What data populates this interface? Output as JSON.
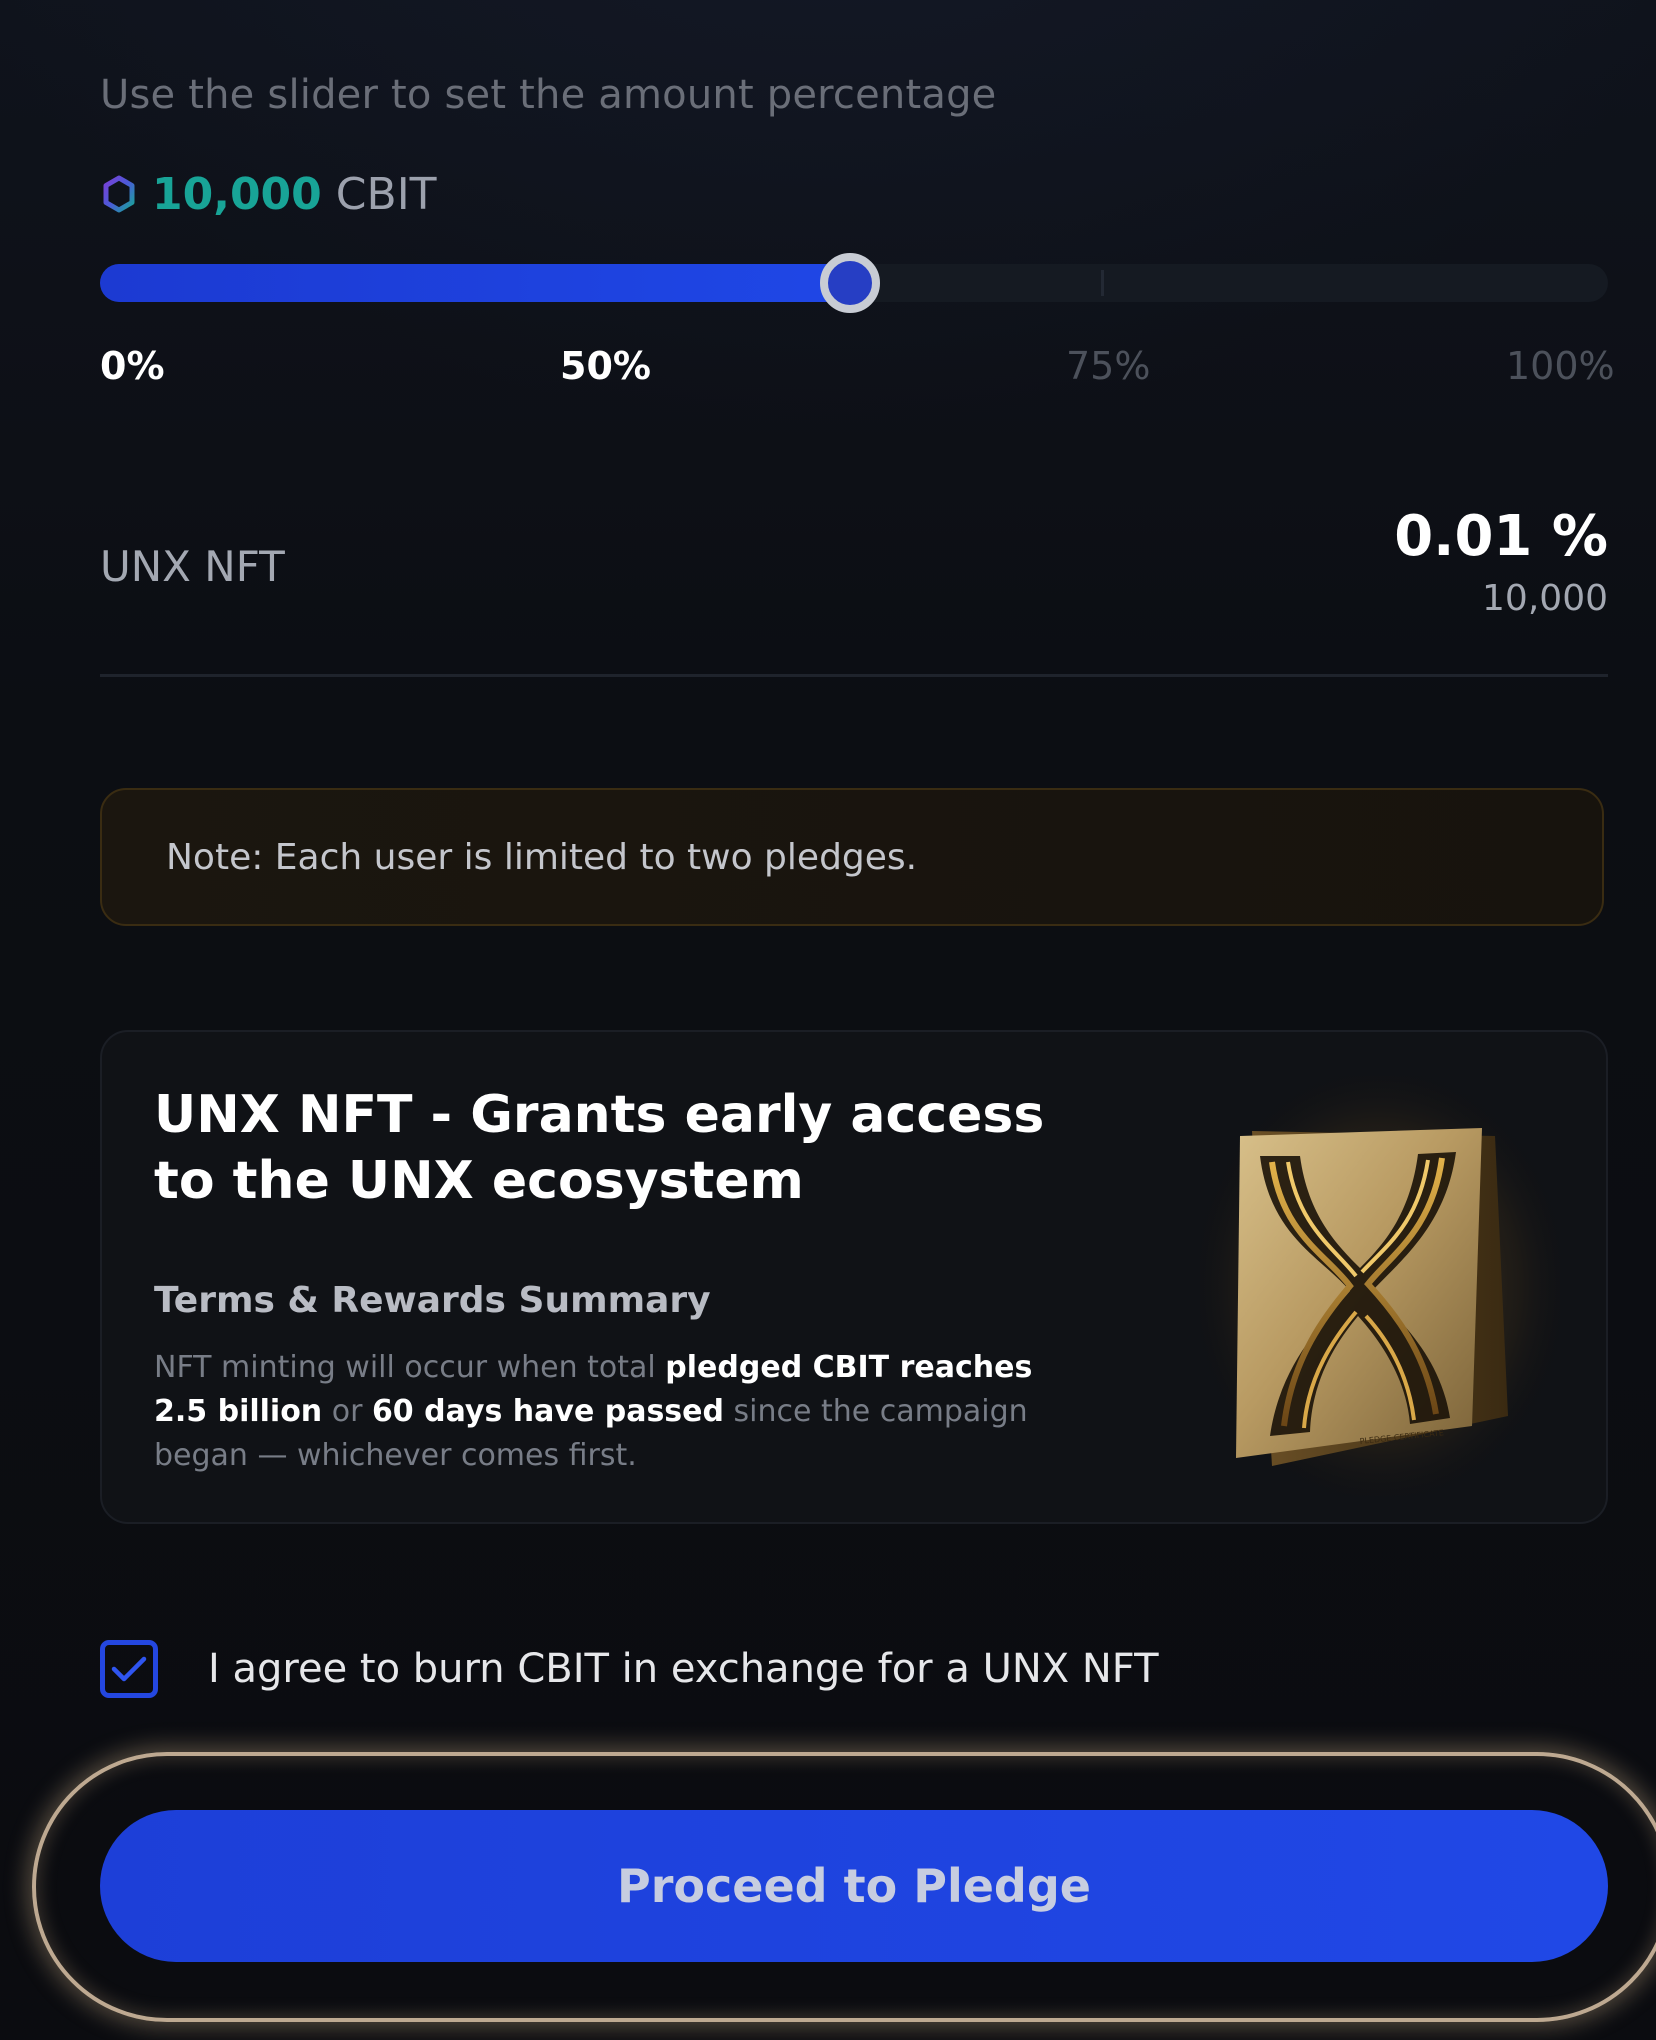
{
  "hint": "Use the slider to set the amount percentage",
  "amount": {
    "icon": "cbit-token-icon",
    "value": "10,000",
    "unit": "CBIT"
  },
  "slider": {
    "value_percent": 50,
    "labels": [
      "0%",
      "50%",
      "75%",
      "100%"
    ]
  },
  "nft": {
    "label": "UNX NFT",
    "percent": "0.01 %",
    "amount": "10,000"
  },
  "note": "Note: Each user is limited to two pledges.",
  "card": {
    "title": "UNX NFT - Grants early access to the UNX ecosystem",
    "subtitle": "Terms & Rewards Summary",
    "desc": {
      "p1": "NFT minting will occur when total ",
      "b1": "pledged CBIT reaches 2.5 billion",
      "p2": " or ",
      "b2": "60 days have passed",
      "p3": " since the campaign began — whichever comes first."
    },
    "image_caption": "PLEDGE CERTIFICATE"
  },
  "agree": {
    "checked": true,
    "text": "I agree to burn CBIT in exchange for a UNX NFT"
  },
  "cta": "Proceed to Pledge",
  "colors": {
    "accent_blue": "#1f47e6",
    "token_teal": "#18a497",
    "note_border": "#3a2c12",
    "glow": "#dec6a8"
  }
}
